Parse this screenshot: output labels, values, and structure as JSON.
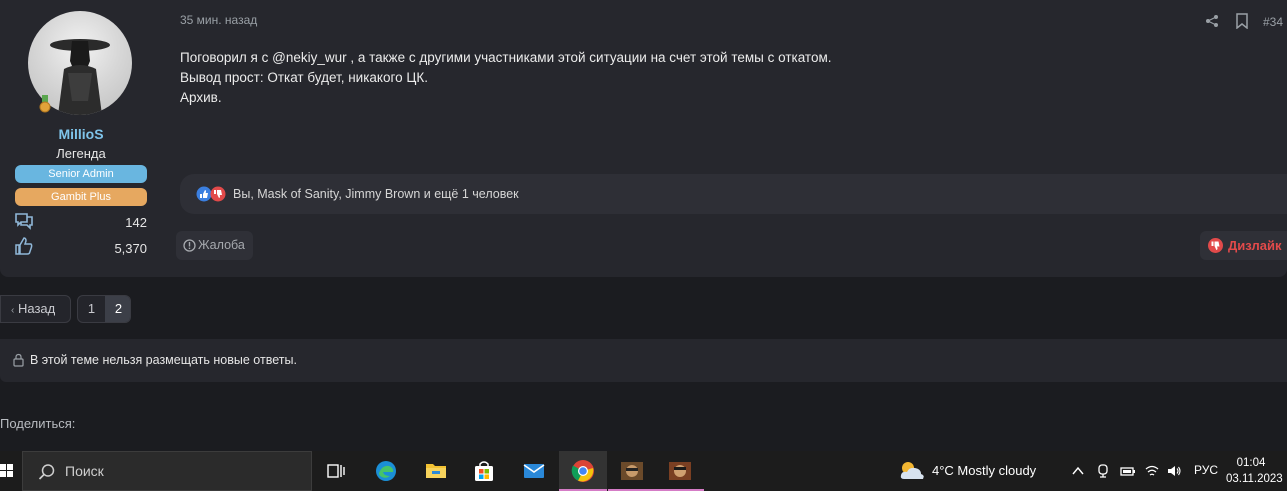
{
  "author": {
    "username": "MillioS",
    "user_title": "Легенда",
    "banners": [
      "Senior Admin",
      "Gambit Plus"
    ],
    "messages_count": "142",
    "reactions_count": "5,370"
  },
  "post": {
    "date": "35 мин. назад",
    "number": "#34",
    "lines": [
      "Поговорил я с @nekiy_wur , а также с другими участниками этой ситуации на счет этой темы с откатом.",
      "Вывод прост: Откат будет, никакого ЦК.",
      "Архив."
    ],
    "reactions_text": "Вы, Mask of Sanity, Jimmy Brown и ещё 1 человек",
    "report_label": "Жалоба",
    "dislike_label": "Дизлайк"
  },
  "pagination": {
    "back_label": "Назад",
    "pages": [
      "1",
      "2"
    ],
    "current": "2"
  },
  "notice": "В этой теме нельзя размещать новые ответы.",
  "share_label": "Поделиться:",
  "taskbar": {
    "search_placeholder": "Поиск",
    "weather": "4°C  Mostly cloudy",
    "language": "РУС",
    "time": "01:04",
    "date": "03.11.2023"
  },
  "colors": {
    "page_bg": "#1b1c20",
    "card_bg": "#26272d",
    "username": "#7fc4ea",
    "admin_banner": "#69b6e0",
    "plus_banner": "#e6a860",
    "dislike": "#e24a4a"
  }
}
